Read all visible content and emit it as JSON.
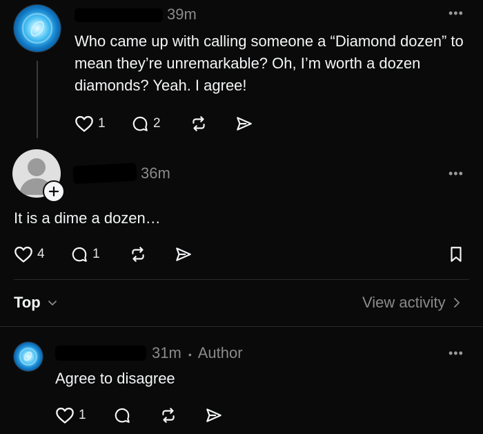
{
  "post": {
    "time": "39m",
    "text": "Who came up with calling someone a “Diamond dozen” to mean they’re unremarkable? Oh, I’m worth a dozen diamonds? Yeah. I agree!",
    "likes": "1",
    "replies": "2"
  },
  "reply": {
    "time": "36m",
    "text": "It is a dime a dozen…",
    "likes": "4",
    "replies": "1"
  },
  "sort_bar": {
    "sort_label": "Top",
    "view_activity": "View activity"
  },
  "comment": {
    "time": "31m",
    "separator": "•",
    "author_tag": "Author",
    "text": "Agree to disagree",
    "likes": "1"
  },
  "icons": {
    "more": "more-horizontal-icon",
    "like": "heart-icon",
    "reply": "comment-icon",
    "repost": "repost-icon",
    "share": "send-icon",
    "save": "bookmark-icon",
    "follow": "plus-icon",
    "dropdown": "chevron-down-icon",
    "arrow": "chevron-right-icon"
  }
}
